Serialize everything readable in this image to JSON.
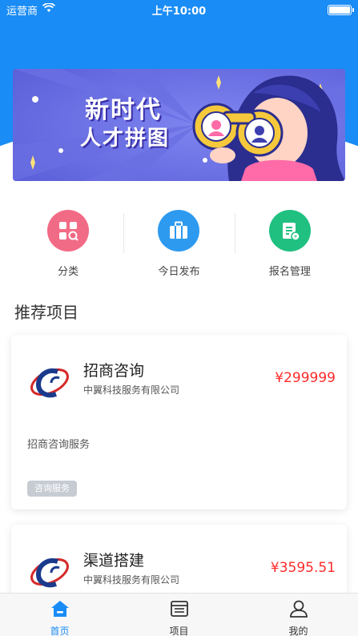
{
  "status_bar": {
    "carrier": "运营商",
    "time": "上午10:00"
  },
  "banner": {
    "title_line1": "新时代",
    "title_line2": "人才拼图"
  },
  "quick_entries": [
    {
      "label": "分类",
      "icon": "category-icon",
      "color": "#f26b86"
    },
    {
      "label": "今日发布",
      "icon": "briefcase-icon",
      "color": "#2d9af0"
    },
    {
      "label": "报名管理",
      "icon": "document-icon",
      "color": "#20c081"
    }
  ],
  "section": {
    "title": "推荐项目"
  },
  "projects": [
    {
      "title": "招商咨询",
      "company": "中翼科技服务有限公司",
      "price": "¥299999",
      "description": "招商咨询服务",
      "tag": "咨询服务"
    },
    {
      "title": "渠道搭建",
      "company": "中翼科技服务有限公司",
      "price": "¥3595.51"
    }
  ],
  "tab_bar": {
    "items": [
      {
        "label": "首页",
        "icon": "home-icon",
        "active": true
      },
      {
        "label": "项目",
        "icon": "list-icon",
        "active": false
      },
      {
        "label": "我的",
        "icon": "profile-icon",
        "active": false
      }
    ]
  },
  "colors": {
    "primary": "#1a8cf5",
    "price": "#ff2a2a",
    "tag_bg": "#c7ccd3"
  }
}
